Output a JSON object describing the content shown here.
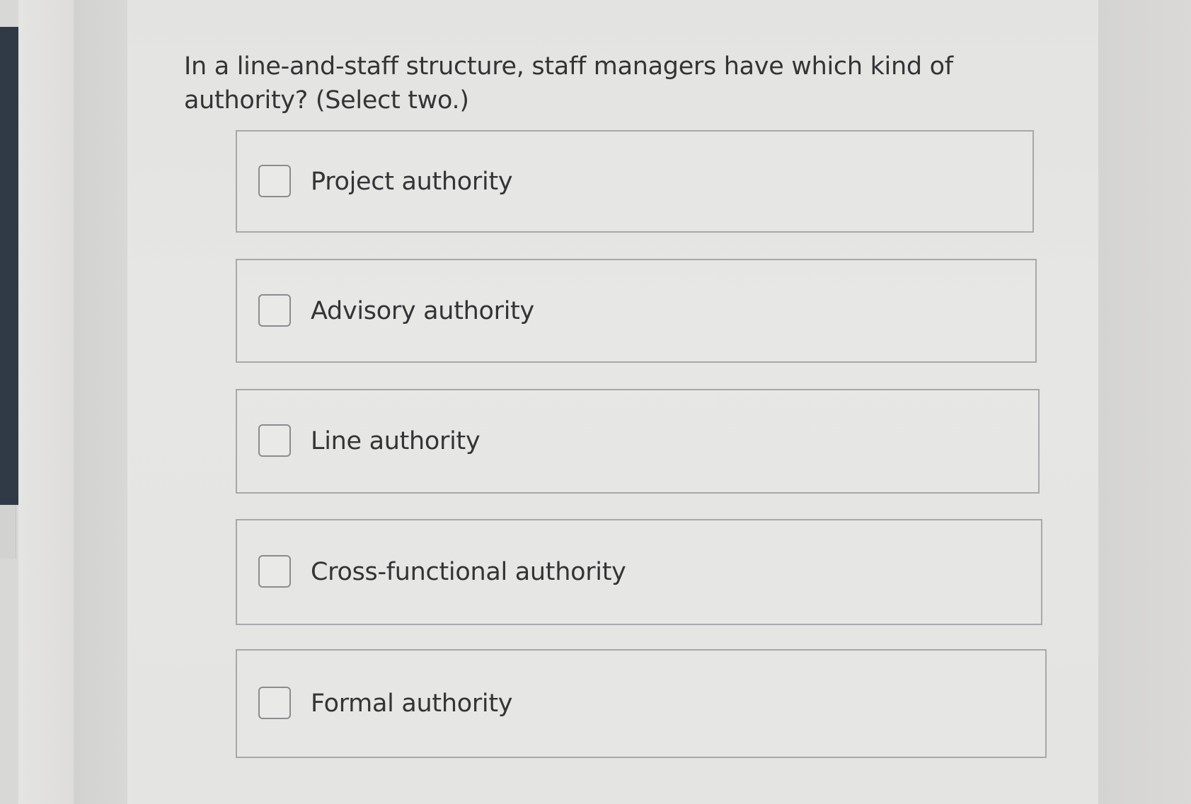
{
  "question": {
    "text": "In a line-and-staff structure, staff managers have which kind of authority? (Select two.)"
  },
  "options": [
    {
      "label": "Project authority",
      "checked": false
    },
    {
      "label": "Advisory authority",
      "checked": false
    },
    {
      "label": "Line authority",
      "checked": false
    },
    {
      "label": "Cross-functional authority",
      "checked": false
    },
    {
      "label": "Formal authority",
      "checked": false
    }
  ],
  "colors": {
    "text": "#333436",
    "option_border": "#a7a8a9",
    "checkbox_border": "#8a8c8e",
    "page_background": "#e4e4e2",
    "edge_bar": "#2f3a46"
  }
}
